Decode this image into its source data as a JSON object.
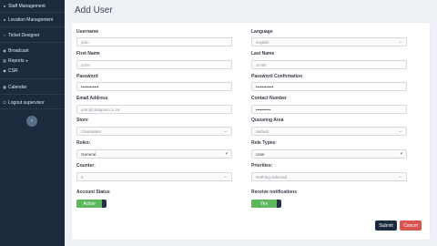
{
  "sidebar": {
    "items": [
      {
        "label": "Staff Management",
        "icon": "people-icon"
      },
      {
        "label": "Location Management",
        "icon": "location-icon"
      },
      {
        "label": "Ticket Designer",
        "icon": "ticket-icon"
      },
      {
        "label": "Broadcast",
        "icon": "broadcast-icon"
      },
      {
        "label": "Reports",
        "icon": "reports-icon"
      },
      {
        "label": "CSR",
        "icon": "csr-icon"
      },
      {
        "label": "Calendar",
        "icon": "calendar-icon"
      },
      {
        "label": "Logout supervisor",
        "icon": "logout-icon"
      }
    ],
    "collapse_glyph": "‹",
    "reports_caret": "▾"
  },
  "page": {
    "title": "Add User"
  },
  "form": {
    "username": {
      "label": "Username",
      "value": "john"
    },
    "language": {
      "label": "Language",
      "value": "english"
    },
    "first_name": {
      "label": "First Name",
      "value": "John"
    },
    "last_name": {
      "label": "Last Name",
      "value": "Smith"
    },
    "password": {
      "label": "Password",
      "value": "••••••••••••"
    },
    "password_confirmation": {
      "label": "Password Confirmation",
      "value": "••••••••••••"
    },
    "email": {
      "label": "Email Address",
      "value": "john@dataport.co.za"
    },
    "contact_number": {
      "label": "Contact Number",
      "value": "••••••••••"
    },
    "store": {
      "label": "Store",
      "value": "Clearwater"
    },
    "queueing_area": {
      "label": "Queueing Area",
      "value": "default"
    },
    "roles": {
      "label": "Roles:",
      "value": "General"
    },
    "role_types": {
      "label": "Role Types:",
      "value": "User"
    },
    "counter": {
      "label": "Counter:",
      "value": "5"
    },
    "priorities": {
      "label": "Priorities:",
      "value": "Nothing selected"
    },
    "account_status": {
      "label": "Account Status",
      "toggle_label": "Active"
    },
    "receive_notifications": {
      "label": "Receive notifications",
      "toggle_label": "Yes"
    }
  },
  "actions": {
    "submit": "Submit",
    "cancel": "Cancel"
  },
  "colors": {
    "sidebar": "#1c2a3e",
    "toggle_on": "#5cb85c",
    "cancel": "#d9534f",
    "submit": "#1c2a3e"
  }
}
